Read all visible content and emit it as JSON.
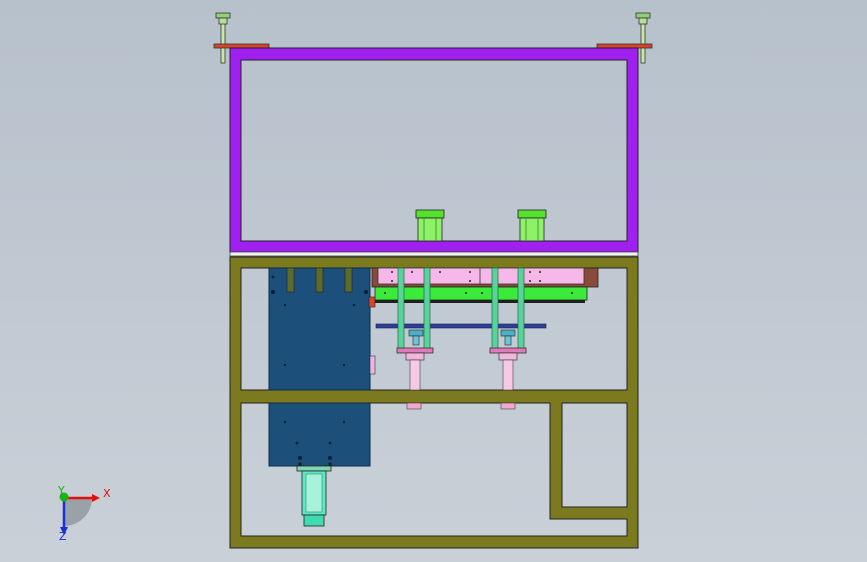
{
  "view": {
    "background_top": "#b7c1cb",
    "background_bottom": "#c9d0d8"
  },
  "colors": {
    "upper_frame": "#a020f0",
    "lower_frame": "#7b7a1f",
    "separator_plate": "#f2f2f2",
    "blue_block": "#1c4f7a",
    "pink_plate": "#f6b8e8",
    "green_plate": "#3bea3b",
    "teal_rods": "#59d39a",
    "cylinder_green": "#56e02e",
    "cylinder_cyan": "#5fe8c4",
    "red_bracket": "#d9432c",
    "axis_x": "#e01010",
    "axis_y": "#12b512",
    "axis_z": "#1a2fd6"
  },
  "triad": {
    "x_label": "X",
    "y_label": "Y",
    "z_label": "Z"
  }
}
